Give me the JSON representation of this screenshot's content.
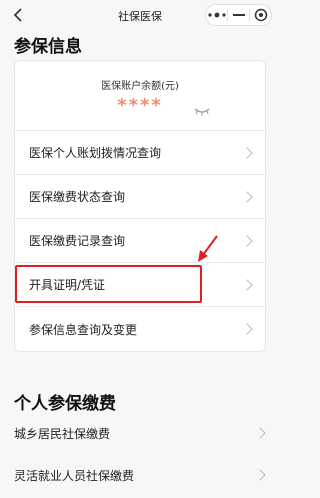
{
  "navbar": {
    "title": "社保医保"
  },
  "insurance_info": {
    "heading": "参保信息",
    "balance_label": "医保账户余额(元)",
    "balance_value": "****",
    "menu": [
      {
        "label": "医保个人账划拨情况查询"
      },
      {
        "label": "医保缴费状态查询"
      },
      {
        "label": "医保缴费记录查询"
      },
      {
        "label": "开具证明/凭证"
      },
      {
        "label": "参保信息查询及变更"
      }
    ]
  },
  "personal_payment": {
    "heading": "个人参保缴费",
    "items": [
      {
        "label": "城乡居民社保缴费"
      },
      {
        "label": "灵活就业人员社保缴费"
      }
    ]
  },
  "colors": {
    "highlight": "#e02020",
    "balance": "#f08b6b"
  }
}
